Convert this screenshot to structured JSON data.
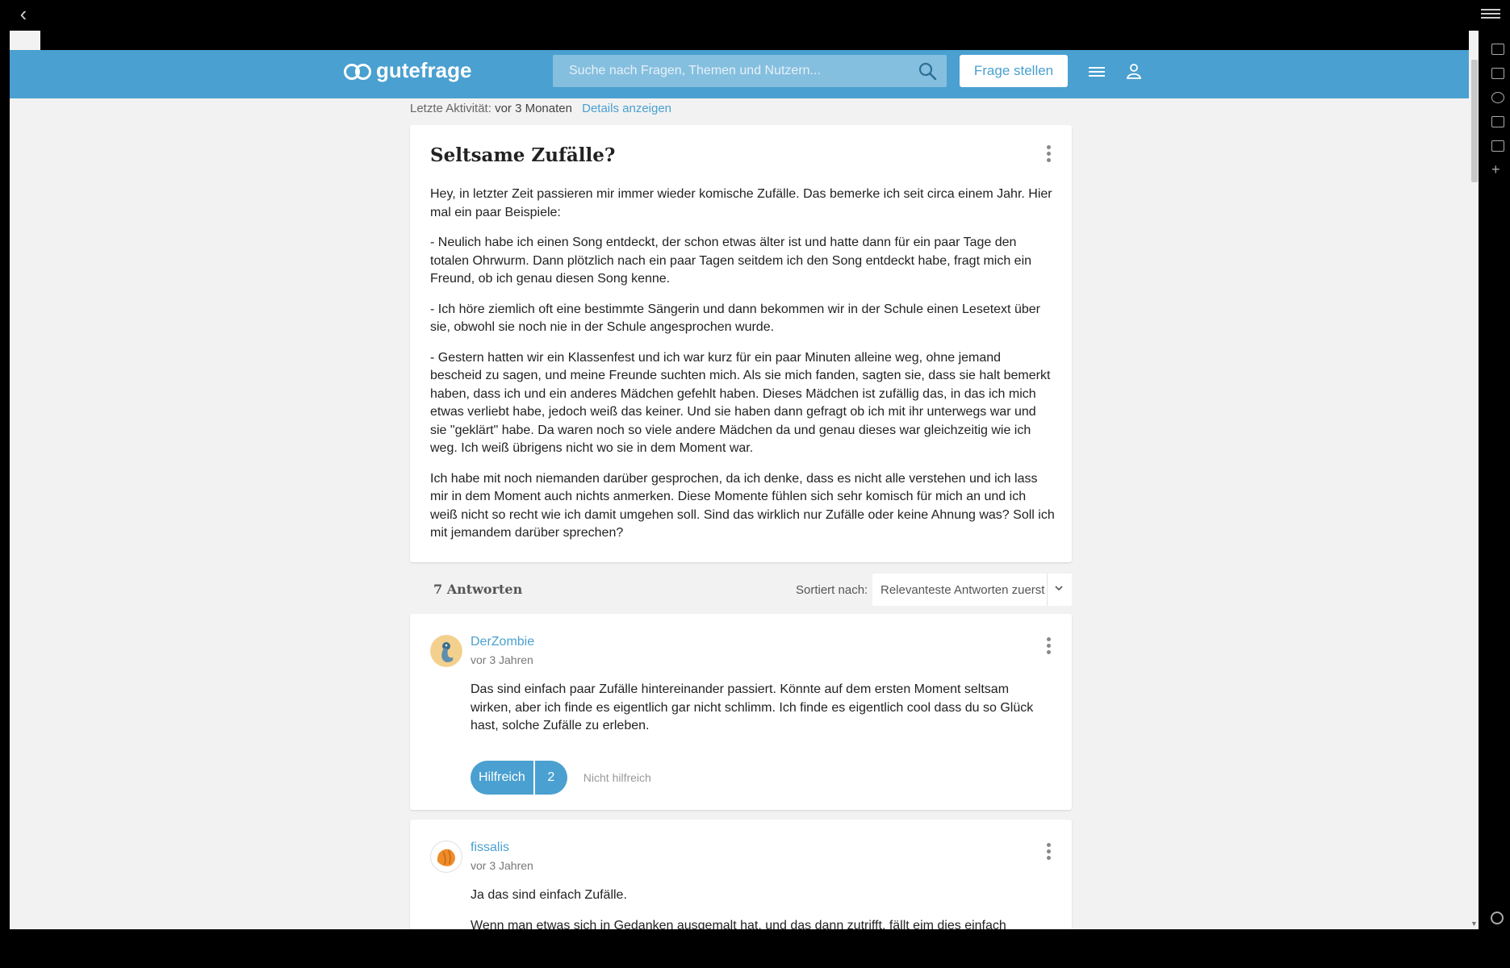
{
  "browser": {
    "back_glyph": "‹"
  },
  "header": {
    "logo_text": "gutefrage",
    "search_placeholder": "Suche nach Fragen, Themen und Nutzern...",
    "ask_label": "Frage stellen",
    "accent_color": "#4aa0d0"
  },
  "activity": {
    "label": "Letzte Aktivität:",
    "value": "vor 3 Monaten",
    "details_link": "Details anzeigen"
  },
  "question": {
    "title": "Seltsame Zufälle?",
    "paragraphs": [
      "Hey, in letzter Zeit passieren mir immer wieder komische Zufälle. Das bemerke ich seit circa einem Jahr. Hier mal ein paar Beispiele:",
      "- Neulich habe ich einen Song entdeckt, der schon etwas älter ist und hatte dann für ein paar Tage den totalen Ohrwurm. Dann plötzlich nach ein paar Tagen seitdem ich den Song entdeckt habe, fragt mich ein Freund, ob ich genau diesen Song kenne.",
      "- Ich höre ziemlich oft eine bestimmte Sängerin und dann bekommen wir in der Schule einen Lesetext über sie, obwohl sie noch nie in der Schule angesprochen wurde.",
      "- Gestern hatten wir ein Klassenfest und ich war kurz für ein paar Minuten alleine weg, ohne jemand bescheid zu sagen, und meine Freunde suchten mich. Als sie mich fanden, sagten sie, dass sie halt bemerkt haben, dass ich und ein anderes Mädchen gefehlt haben. Dieses Mädchen ist zufällig das, in das ich mich etwas verliebt habe, jedoch weiß das keiner. Und sie haben dann gefragt ob ich mit ihr unterwegs war und sie \"geklärt\" habe. Da waren noch so viele andere Mädchen da und genau dieses war gleichzeitig wie ich weg. Ich weiß übrigens nicht wo sie in dem Moment war.",
      "Ich habe mit noch niemanden darüber gesprochen, da ich denke, dass es nicht alle verstehen und ich lass mir in dem Moment auch nichts anmerken. Diese Momente fühlen sich sehr komisch für mich an und ich weiß nicht so recht wie ich damit umgehen soll. Sind das wirklich nur Zufälle oder keine Ahnung was? Soll ich mit jemandem darüber sprechen?"
    ]
  },
  "answers_bar": {
    "count_label": "7 Antworten",
    "sort_label": "Sortiert nach:",
    "sort_value": "Relevanteste Antworten zuerst"
  },
  "answers": [
    {
      "author": "DerZombie",
      "time": "vor 3 Jahren",
      "paragraphs": [
        "Das sind einfach paar Zufälle hintereinander passiert. Könnte auf dem ersten Moment seltsam wirken, aber ich finde es eigentlich gar nicht schlimm. Ich finde es eigentlich cool dass du so Glück hast, solche Zufälle zu erleben."
      ],
      "helpful_label": "Hilfreich",
      "helpful_count": "2",
      "unhelpful_label": "Nicht hilfreich"
    },
    {
      "author": "fissalis",
      "time": "vor 3 Jahren",
      "paragraphs": [
        "Ja das sind einfach Zufälle.",
        "Wenn man etwas sich in Gedanken ausgemalt hat, und das dann zutrifft, fällt eim dies einfach"
      ]
    }
  ]
}
